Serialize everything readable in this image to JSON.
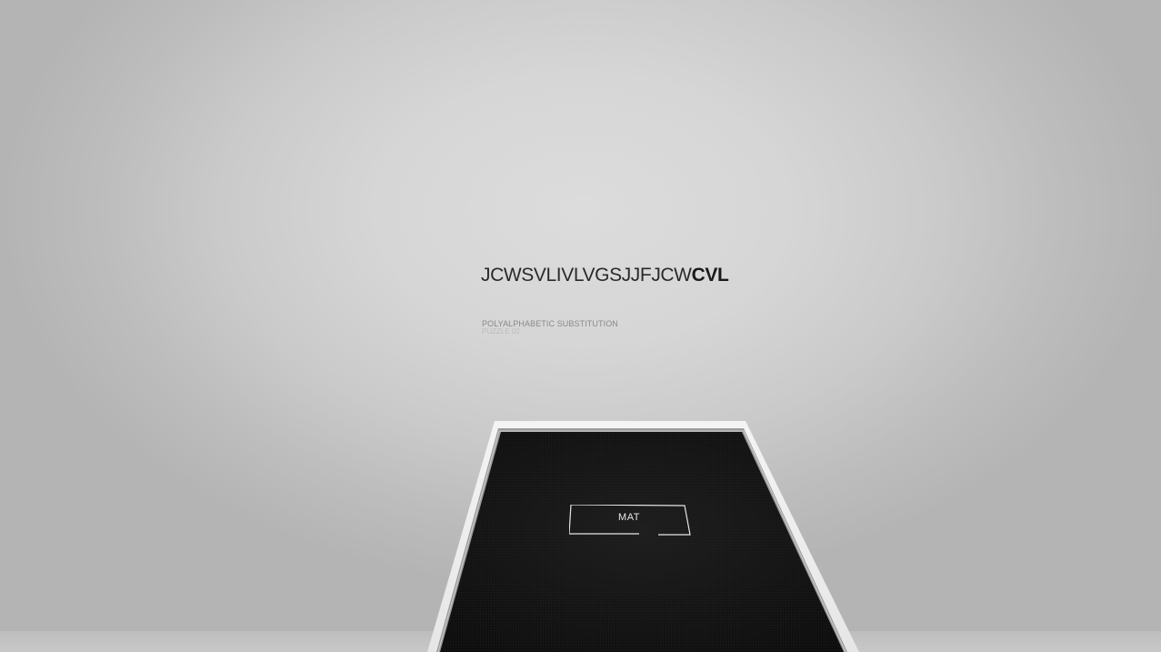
{
  "puzzle": {
    "ciphertext_solved": "JCWSVLIVLVGSJJFJCW",
    "ciphertext_active": "CVL",
    "type_label": "POLYALPHABETIC SUBSTITUTION",
    "number_label": "PUZZLE 02"
  },
  "answer": {
    "value": "MAT"
  },
  "colors": {
    "wall": "#d6d6d6",
    "pedestal_top": "#151515",
    "pedestal_rim": "#f2f2f2",
    "text_dark": "#2a2a2a",
    "answer_text": "#e8e8e8"
  }
}
